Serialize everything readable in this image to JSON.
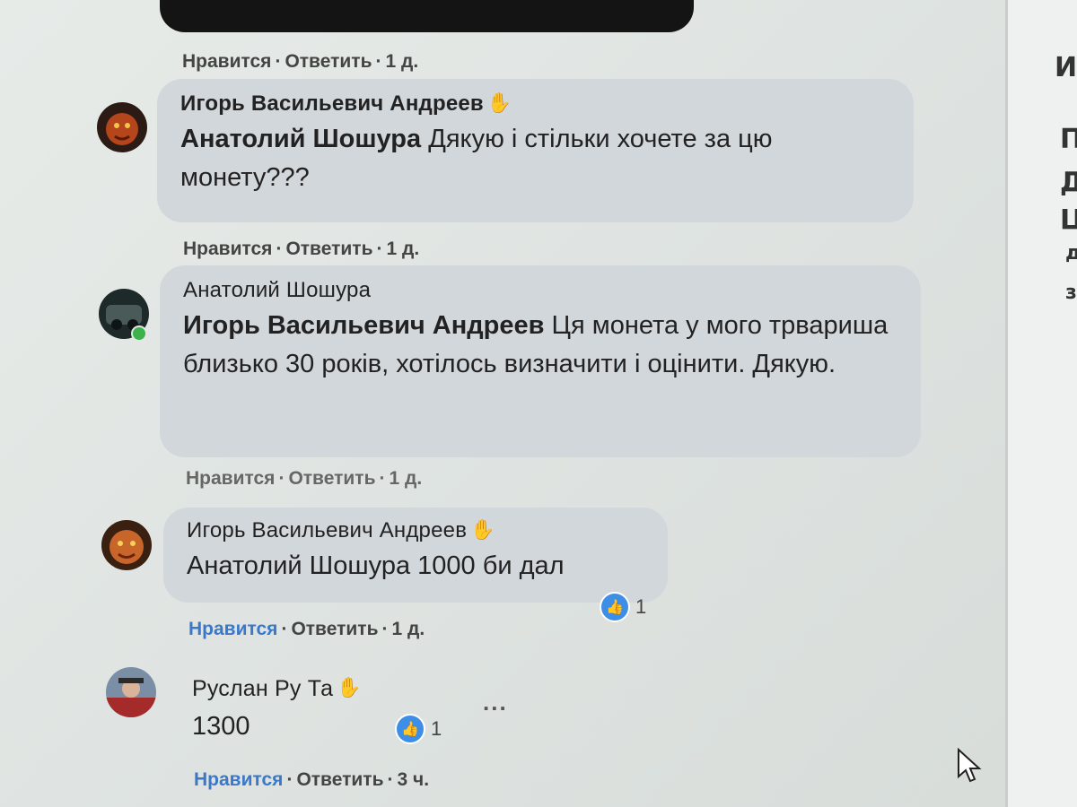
{
  "right_panel": {
    "chars": [
      "И",
      "П",
      "Д",
      "Ц",
      "д",
      "з"
    ]
  },
  "actions": {
    "like": "Нравится",
    "reply": "Ответить",
    "sep": "·"
  },
  "comments": [
    {
      "time": "1 д."
    },
    {
      "author": "Игорь Васильевич Андреев",
      "mention": "Анатолий Шошура",
      "text": " Дякую і стільки хочете за цю монету???",
      "time": "1 д."
    },
    {
      "author": "Анатолий Шошура",
      "mention": "Игорь Васильевич Андреев",
      "text": " Ця монета у мого трвариша близько 30 років, хотілось визначити і оцінити. Дякую.",
      "time": "1 д."
    },
    {
      "author": "Игорь Васильевич Андреев",
      "mention": "Анатолий Шошура",
      "text": " 1000 би дал",
      "time": "1 д.",
      "likes": "1"
    },
    {
      "author": "Руслан Ру Та",
      "text": "1300",
      "time": "3 ч.",
      "likes": "1",
      "more": "..."
    }
  ]
}
